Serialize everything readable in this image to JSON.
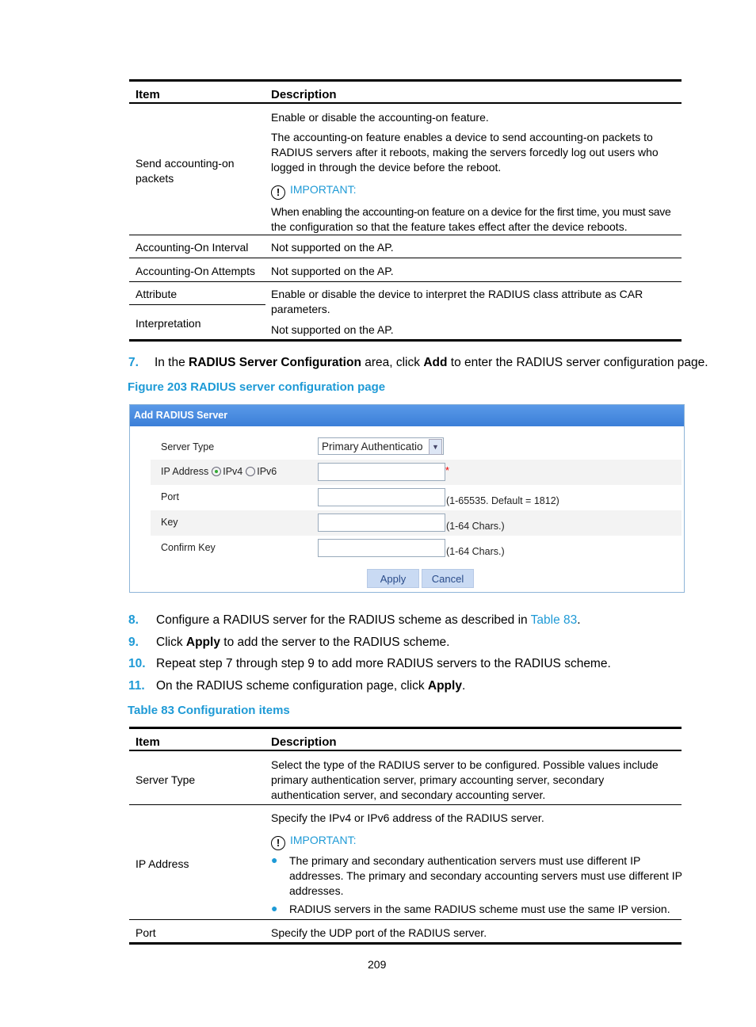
{
  "table1": {
    "headers": [
      "Item",
      "Description"
    ],
    "rows": [
      {
        "item": [
          "Send accounting-on",
          "packets"
        ],
        "desc": [
          "Enable or disable the accounting-on feature.",
          "The accounting-on feature enables a device to send accounting-on packets to",
          "RADIUS servers after it reboots, making the servers forcedly log out users who",
          "logged in through the device before the reboot."
        ],
        "important": "IMPORTANT:",
        "note": [
          "When enabling the accounting-on feature on a device for the first time, you must save",
          "the configuration so that the feature takes effect after the device reboots."
        ]
      },
      {
        "item": [
          "Accounting-On Interval"
        ],
        "desc": [
          "Not supported on the AP."
        ]
      },
      {
        "item": [
          "Accounting-On Attempts"
        ],
        "desc": [
          "Not supported on the AP."
        ]
      },
      {
        "item": [
          "Attribute"
        ],
        "desc": [
          "Enable or disable the device to interpret the RADIUS class attribute as CAR",
          "parameters."
        ]
      },
      {
        "item": [
          "Interpretation"
        ],
        "desc": [
          "Not supported on the AP."
        ]
      }
    ]
  },
  "step7": {
    "num": "7.",
    "t1": "In the ",
    "b1": "RADIUS Server Configuration",
    "t2": " area, click ",
    "b2": "Add",
    "t3": " to enter the RADIUS server configuration page."
  },
  "figure_caption": "Figure 203 RADIUS server configuration page",
  "dialog": {
    "title": "Add RADIUS Server",
    "server_type_label": "Server Type",
    "server_type_value": "Primary Authenticatio",
    "ip_label": "IP Address",
    "ipv4": "IPv4",
    "ipv6": "IPv6",
    "ip_selected": "IPv4",
    "required_mark": "*",
    "port_label": "Port",
    "port_hint": "(1-65535. Default = 1812)",
    "key_label": "Key",
    "key_hint": "(1-64 Chars.)",
    "confirm_label": "Confirm Key",
    "confirm_hint": "(1-64 Chars.)",
    "apply": "Apply",
    "cancel": "Cancel"
  },
  "steps": [
    {
      "num": "8.",
      "t1": "Configure a RADIUS server for the RADIUS scheme as described in ",
      "link": "Table 83",
      "t2": "."
    },
    {
      "num": "9.",
      "t1": "Click ",
      "b": "Apply",
      "t2": " to add the server to the RADIUS scheme."
    },
    {
      "num": "10.",
      "t1": "Repeat step 7 through step 9 to add more RADIUS servers to the RADIUS scheme."
    },
    {
      "num": "11.",
      "t1": "On the RADIUS scheme configuration page, click ",
      "b": "Apply",
      "t2": "."
    }
  ],
  "table83_caption": "Table 83 Configuration items",
  "table2": {
    "headers": [
      "Item",
      "Description"
    ],
    "rows": [
      {
        "item": "Server Type",
        "desc": [
          "Select the type of the RADIUS server to be configured. Possible values include",
          "primary authentication server, primary accounting server, secondary",
          "authentication server, and secondary accounting server."
        ]
      },
      {
        "item": "IP Address",
        "desc": [
          "Specify the IPv4 or IPv6 address of the RADIUS server."
        ],
        "important": "IMPORTANT:",
        "bullets": [
          [
            "The primary and secondary authentication servers must use different IP",
            "addresses. The primary and secondary accounting servers must use different IP",
            "addresses."
          ],
          [
            "RADIUS servers in the same RADIUS scheme must use the same IP version."
          ]
        ]
      },
      {
        "item": "Port",
        "desc": [
          "Specify the UDP port of the RADIUS server."
        ]
      }
    ]
  },
  "page_number": "209"
}
